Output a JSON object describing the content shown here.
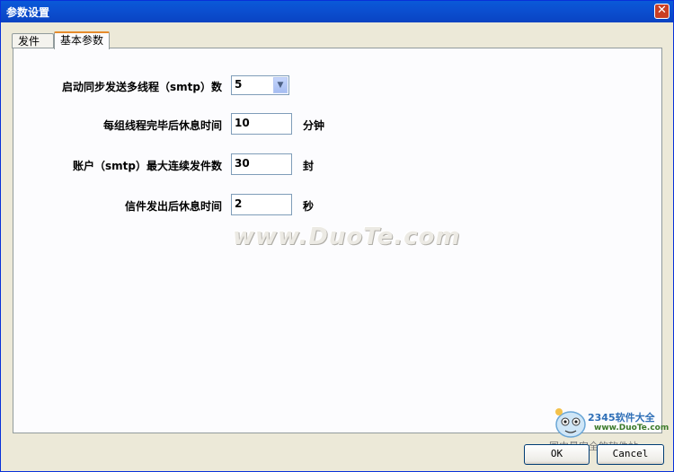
{
  "window": {
    "title": "参数设置"
  },
  "tabs": [
    {
      "label": "发件箱",
      "active": false
    },
    {
      "label": "基本参数",
      "active": true
    }
  ],
  "settings": {
    "threads": {
      "label": "启动同步发送多线程（smtp）数",
      "value": "5"
    },
    "rest_per_group": {
      "label": "每组线程完毕后休息时间",
      "value": "10",
      "unit": "分钟"
    },
    "max_consecutive": {
      "label": "账户（smtp）最大连续发件数",
      "value": "30",
      "unit": "封"
    },
    "rest_after_send": {
      "label": "信件发出后休息时间",
      "value": "2",
      "unit": "秒"
    }
  },
  "watermark": "www.DuoTe.com",
  "logo": {
    "name": "2345软件大全",
    "url": "www.DuoTe.com",
    "caption": "国内最安全的软件站"
  },
  "buttons": {
    "ok": "OK",
    "cancel": "Cancel"
  },
  "colors": {
    "titlebar": "#0a5ad8",
    "tab_accent": "#e68b2c",
    "panel_bg": "#fcfcfe"
  }
}
